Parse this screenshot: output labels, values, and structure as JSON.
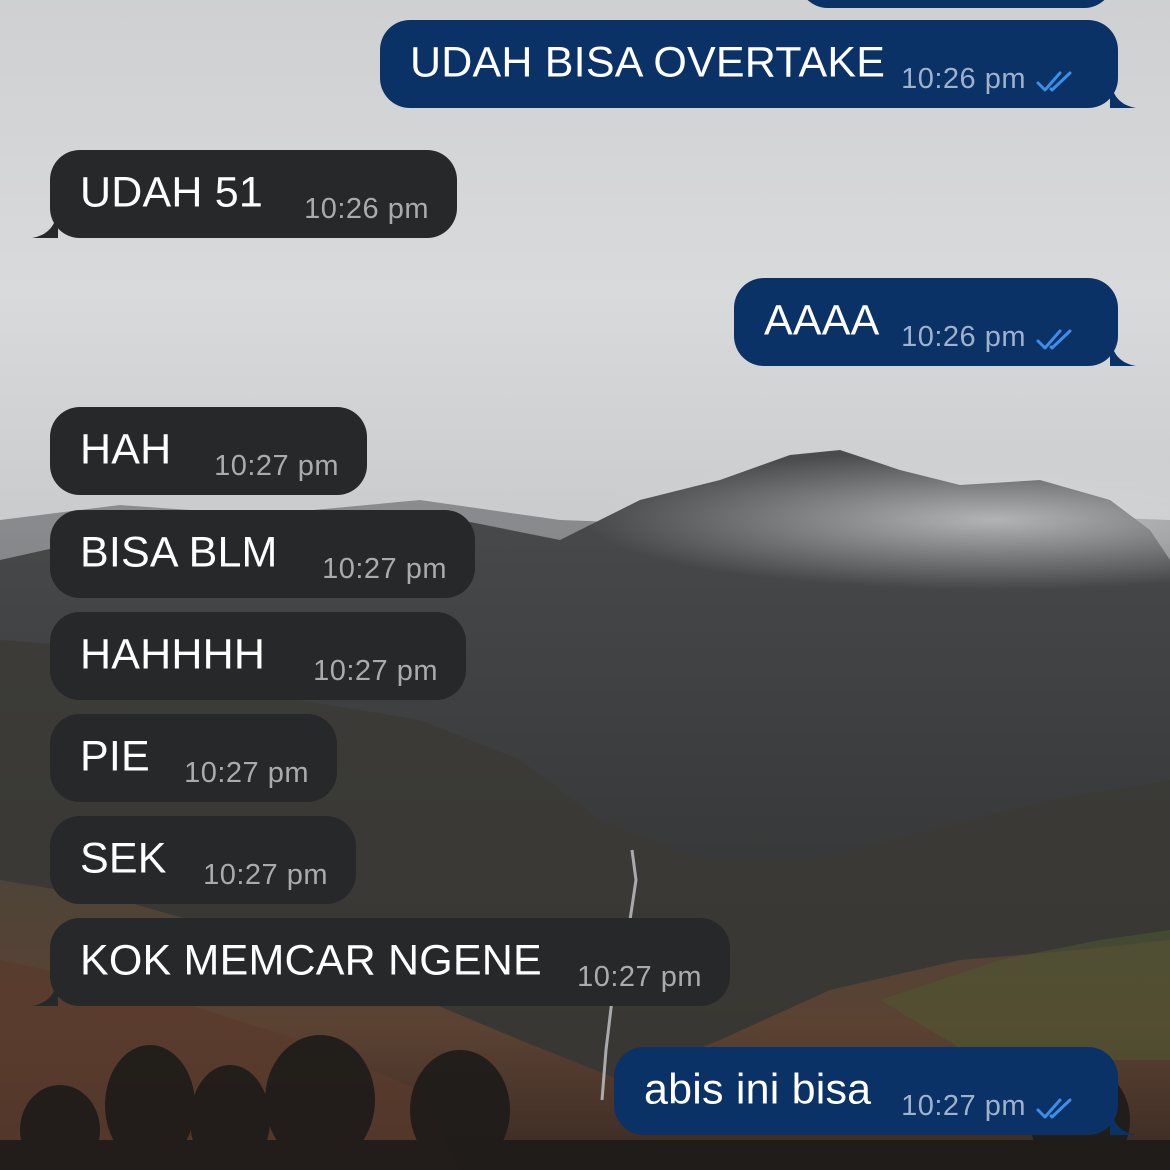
{
  "messages": [
    {
      "side": "out",
      "text": "UDAH BISA OVERTAKE",
      "time": "10:26 pm",
      "status": "read"
    },
    {
      "side": "in",
      "text": "UDAH 51",
      "time": "10:26 pm"
    },
    {
      "side": "out",
      "text": "AAAA",
      "time": "10:26 pm",
      "status": "read"
    },
    {
      "side": "in",
      "text": "HAH",
      "time": "10:27 pm"
    },
    {
      "side": "in",
      "text": "BISA BLM",
      "time": "10:27 pm"
    },
    {
      "side": "in",
      "text": "HAHHHH",
      "time": "10:27 pm"
    },
    {
      "side": "in",
      "text": "PIE",
      "time": "10:27 pm"
    },
    {
      "side": "in",
      "text": "SEK",
      "time": "10:27 pm"
    },
    {
      "side": "in",
      "text": "KOK MEMCAR NGENE",
      "time": "10:27 pm"
    },
    {
      "side": "out",
      "text": "abis ini bisa",
      "time": "10:27 pm",
      "status": "read"
    }
  ],
  "colors": {
    "outgoing_bubble": "#0b3266",
    "incoming_bubble": "#262829",
    "read_ticks": "#3d8ee8"
  }
}
